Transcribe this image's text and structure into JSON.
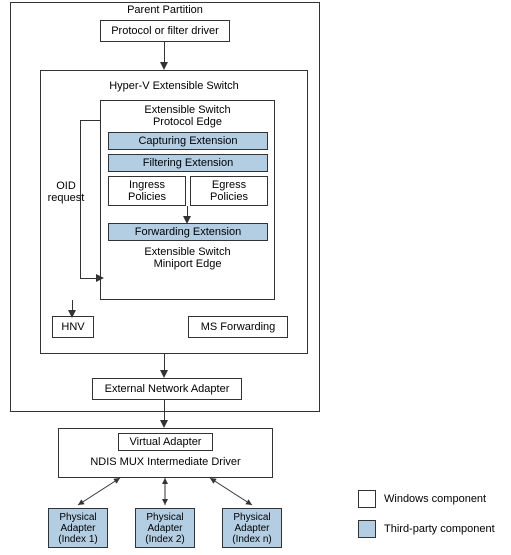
{
  "parent_partition": {
    "title": "Parent Partition",
    "protocol_driver": "Protocol or filter driver",
    "switch_title": "Hyper-V Extensible Switch",
    "protocol_edge": "Extensible Switch\nProtocol Edge",
    "capturing": "Capturing Extension",
    "filtering": "Filtering Extension",
    "ingress": "Ingress\nPolicies",
    "egress": "Egress\nPolicies",
    "forwarding": "Forwarding Extension",
    "miniport_edge": "Extensible Switch\nMiniport Edge",
    "oid_label": "OID\nrequest",
    "hnv": "HNV",
    "ms_forwarding": "MS Forwarding",
    "ext_adapter": "External Network Adapter"
  },
  "mux": {
    "virtual_adapter": "Virtual Adapter",
    "title": "NDIS MUX Intermediate Driver"
  },
  "physical": {
    "a1": "Physical\nAdapter\n(Index 1)",
    "a2": "Physical\nAdapter\n(Index 2)",
    "a3": "Physical\nAdapter\n(Index n)"
  },
  "legend": {
    "win": "Windows component",
    "tp": "Third-party component"
  },
  "chart_data": {
    "type": "diagram",
    "title": "Hyper-V Extensible Switch OID control path to physical adapters",
    "nodes": [
      {
        "id": "protocol_driver",
        "label": "Protocol or filter driver",
        "kind": "windows"
      },
      {
        "id": "hyperv_switch",
        "label": "Hyper-V Extensible Switch",
        "kind": "container",
        "children": [
          {
            "id": "protocol_edge",
            "label": "Extensible Switch Protocol Edge",
            "kind": "windows"
          },
          {
            "id": "capturing",
            "label": "Capturing Extension",
            "kind": "third-party"
          },
          {
            "id": "filtering",
            "label": "Filtering Extension",
            "kind": "third-party"
          },
          {
            "id": "ingress_policies",
            "label": "Ingress Policies",
            "kind": "windows"
          },
          {
            "id": "egress_policies",
            "label": "Egress Policies",
            "kind": "windows"
          },
          {
            "id": "forwarding",
            "label": "Forwarding Extension",
            "kind": "third-party"
          },
          {
            "id": "miniport_edge",
            "label": "Extensible Switch Miniport Edge",
            "kind": "windows"
          },
          {
            "id": "hnv",
            "label": "HNV",
            "kind": "windows"
          },
          {
            "id": "ms_forwarding",
            "label": "MS Forwarding",
            "kind": "windows"
          }
        ]
      },
      {
        "id": "external_adapter",
        "label": "External Network Adapter",
        "kind": "windows"
      },
      {
        "id": "mux",
        "label": "NDIS MUX Intermediate Driver",
        "kind": "container",
        "children": [
          {
            "id": "virtual_adapter",
            "label": "Virtual Adapter",
            "kind": "windows"
          }
        ]
      },
      {
        "id": "phys1",
        "label": "Physical Adapter (Index 1)",
        "kind": "third-party"
      },
      {
        "id": "phys2",
        "label": "Physical Adapter (Index 2)",
        "kind": "third-party"
      },
      {
        "id": "phys3",
        "label": "Physical Adapter (Index n)",
        "kind": "third-party"
      }
    ],
    "edges": [
      {
        "from": "protocol_driver",
        "to": "hyperv_switch",
        "dir": "down"
      },
      {
        "from": "protocol_edge",
        "to": "miniport_edge",
        "dir": "down",
        "label": "OID request",
        "via": [
          "capturing",
          "filtering",
          "ingress_policies",
          "forwarding"
        ]
      },
      {
        "from": "hyperv_switch",
        "to": "external_adapter",
        "dir": "down"
      },
      {
        "from": "external_adapter",
        "to": "virtual_adapter",
        "dir": "down"
      },
      {
        "from": "mux",
        "to": "phys1",
        "dir": "both"
      },
      {
        "from": "mux",
        "to": "phys2",
        "dir": "both"
      },
      {
        "from": "mux",
        "to": "phys3",
        "dir": "both"
      }
    ],
    "legend": [
      {
        "swatch": "white",
        "label": "Windows component"
      },
      {
        "swatch": "blue",
        "label": "Third-party component"
      }
    ]
  }
}
